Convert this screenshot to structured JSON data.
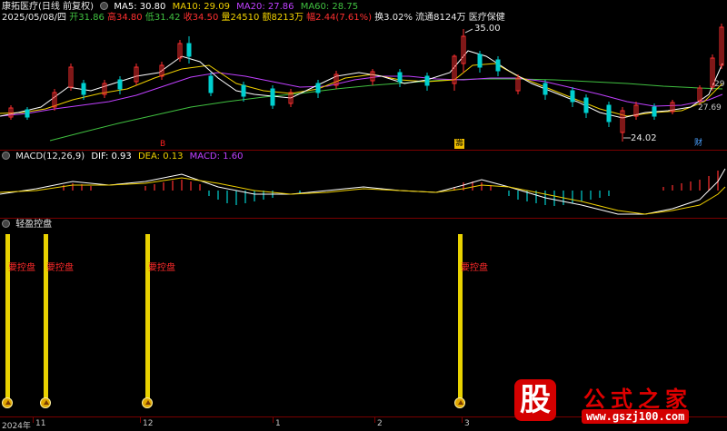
{
  "header": {
    "stock_name": "康拓医疗(日线 前复权)",
    "ma5": "MA5: 30.80",
    "ma10": "MA10: 29.09",
    "ma20": "MA20: 27.86",
    "ma60": "MA60: 28.75",
    "date": "2025/05/08/四",
    "open": "开31.86",
    "high": "高34.80",
    "low": "低31.42",
    "close": "收34.50",
    "volume": "量24510",
    "amount": "额8213万",
    "change": "幅2.44(7.61%)",
    "turnover": "换3.02%",
    "float": "流通8124万",
    "sector": "医疗保健"
  },
  "price_panel": {
    "max_label": "35.00",
    "min_label": "24.02",
    "right_label_1": "29",
    "right_label_2": "27.69",
    "event_marks": [
      {
        "text": "B",
        "color": "#ff2020"
      },
      {
        "text": "籌",
        "color": "#f0c000"
      },
      {
        "text": "财",
        "color": "#4aa0ff"
      }
    ]
  },
  "macd_panel": {
    "title": "MACD(12,26,9)",
    "dif": "DIF: 0.93",
    "dea": "DEA: 0.13",
    "macd": "MACD: 1.60"
  },
  "indicator_panel": {
    "title": "轻盈控盘",
    "signal_label": "要控盘"
  },
  "time_axis": {
    "labels": [
      "2024年",
      "11",
      "12",
      "1",
      "2",
      "3"
    ]
  },
  "watermark": {
    "glyph": "股",
    "text": "公式之家",
    "url": "www.gszj100.com"
  },
  "colors": {
    "background": "#000000",
    "up": "#ff3030",
    "down": "#00d0d0",
    "ma5": "#ffffff",
    "ma10": "#f0d000",
    "ma20": "#c040ff",
    "ma60": "#40c040",
    "signal": "#e9d200"
  }
}
